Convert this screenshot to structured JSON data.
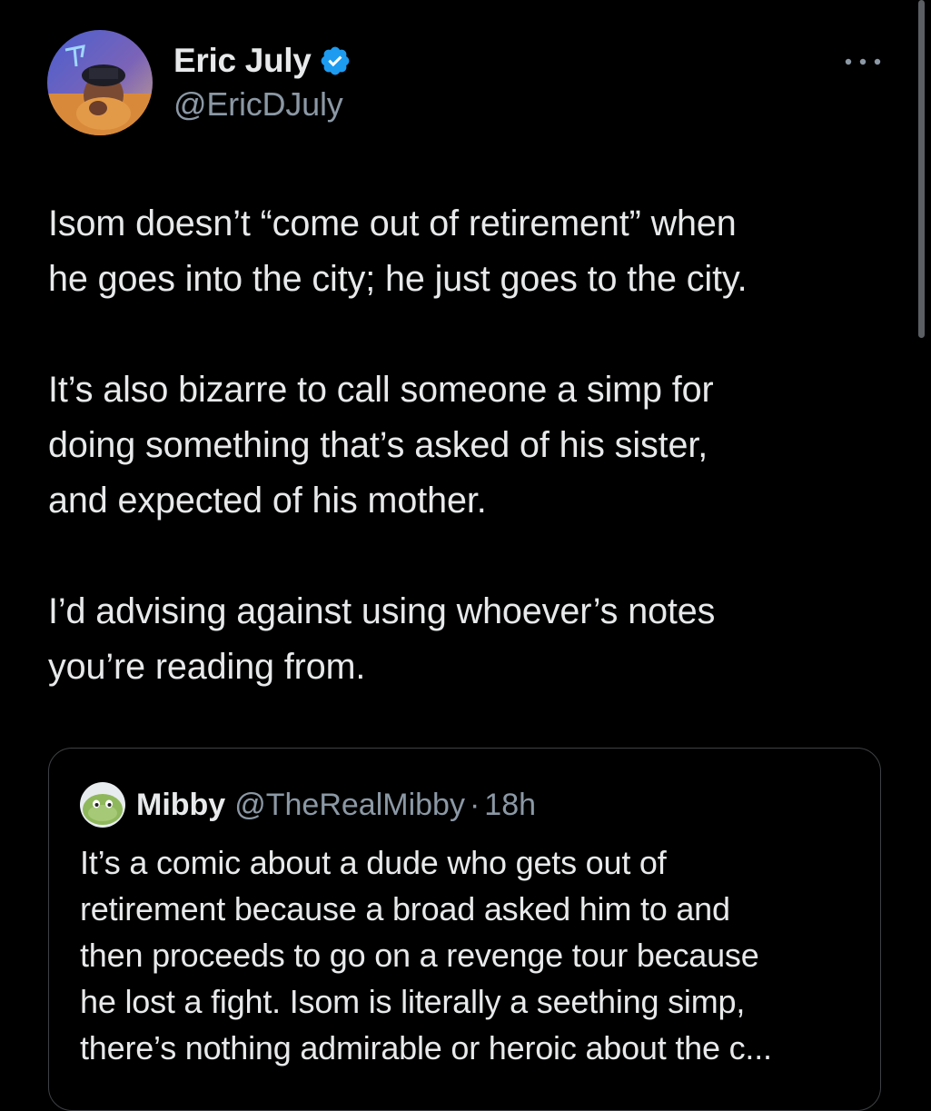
{
  "tweet": {
    "author": {
      "name": "Eric July",
      "handle": "@EricDJuly",
      "avatar_icon": "profile-photo",
      "verified_icon": "verified-badge-icon"
    },
    "more_icon": "more-options-icon",
    "paragraphs": [
      "Isom doesn’t “come out of retirement” when\nhe goes into the city; he just goes to the city.",
      "It’s also bizarre to call someone a simp for\ndoing something that’s asked of his sister,\nand expected of his mother.",
      "I’d advising against using whoever’s notes\nyou’re reading from."
    ]
  },
  "quote": {
    "author_name": "Mibby",
    "author_handle": "@TheRealMibby",
    "separator": "·",
    "time": "18h",
    "avatar_icon": "green-cartoon-avatar",
    "text_lines": [
      "It’s a comic about a dude who gets out of",
      "retirement because a broad asked him to and",
      "then proceeds to go on a revenge tour because",
      "he lost a fight. Isom is literally a seething simp,",
      "there’s nothing admirable or heroic about the c..."
    ]
  },
  "colors": {
    "background": "#000000",
    "primary_text": "#e7e9ea",
    "secondary_text": "#8b98a5",
    "verified_blue": "#1d9bf0",
    "card_border": "#3e4144"
  }
}
